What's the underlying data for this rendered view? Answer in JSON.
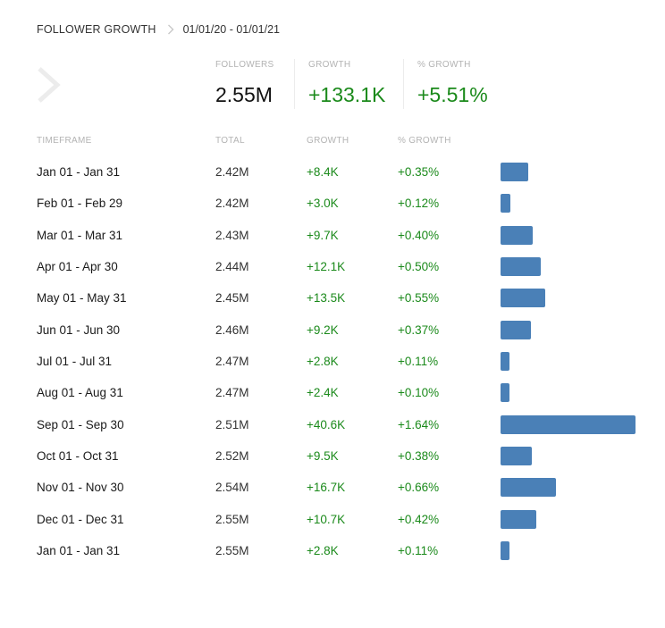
{
  "breadcrumb": {
    "title": "FOLLOWER GROWTH",
    "range": "01/01/20 - 01/01/21"
  },
  "summary": {
    "followers_label": "FOLLOWERS",
    "followers_value": "2.55M",
    "growth_label": "GROWTH",
    "growth_value": "+133.1K",
    "pct_label": "% GROWTH",
    "pct_value": "+5.51%"
  },
  "table": {
    "headers": {
      "timeframe": "TIMEFRAME",
      "total": "TOTAL",
      "growth": "GROWTH",
      "pct": "% GROWTH"
    },
    "rows": [
      {
        "timeframe": "Jan 01 - Jan 31",
        "total": "2.42M",
        "growth": "+8.4K",
        "pct": "+0.35%",
        "growth_num": 8.4
      },
      {
        "timeframe": "Feb 01 - Feb 29",
        "total": "2.42M",
        "growth": "+3.0K",
        "pct": "+0.12%",
        "growth_num": 3.0
      },
      {
        "timeframe": "Mar 01 - Mar 31",
        "total": "2.43M",
        "growth": "+9.7K",
        "pct": "+0.40%",
        "growth_num": 9.7
      },
      {
        "timeframe": "Apr 01 - Apr 30",
        "total": "2.44M",
        "growth": "+12.1K",
        "pct": "+0.50%",
        "growth_num": 12.1
      },
      {
        "timeframe": "May 01 - May 31",
        "total": "2.45M",
        "growth": "+13.5K",
        "pct": "+0.55%",
        "growth_num": 13.5
      },
      {
        "timeframe": "Jun 01 - Jun 30",
        "total": "2.46M",
        "growth": "+9.2K",
        "pct": "+0.37%",
        "growth_num": 9.2
      },
      {
        "timeframe": "Jul 01 - Jul 31",
        "total": "2.47M",
        "growth": "+2.8K",
        "pct": "+0.11%",
        "growth_num": 2.8
      },
      {
        "timeframe": "Aug 01 - Aug 31",
        "total": "2.47M",
        "growth": "+2.4K",
        "pct": "+0.10%",
        "growth_num": 2.4
      },
      {
        "timeframe": "Sep 01 - Sep 30",
        "total": "2.51M",
        "growth": "+40.6K",
        "pct": "+1.64%",
        "growth_num": 40.6
      },
      {
        "timeframe": "Oct 01 - Oct 31",
        "total": "2.52M",
        "growth": "+9.5K",
        "pct": "+0.38%",
        "growth_num": 9.5
      },
      {
        "timeframe": "Nov 01 - Nov 30",
        "total": "2.54M",
        "growth": "+16.7K",
        "pct": "+0.66%",
        "growth_num": 16.7
      },
      {
        "timeframe": "Dec 01 - Dec 31",
        "total": "2.55M",
        "growth": "+10.7K",
        "pct": "+0.42%",
        "growth_num": 10.7
      },
      {
        "timeframe": "Jan 01 - Jan 31",
        "total": "2.55M",
        "growth": "+2.8K",
        "pct": "+0.11%",
        "growth_num": 2.8
      }
    ]
  },
  "icons": {
    "breadcrumb_separator": "chevron-right-icon",
    "back_arrow": "chevron-right-icon"
  },
  "colors": {
    "positive": "#1b8a1b",
    "bar": "#4a80b7",
    "muted_label": "#b3b3b3"
  }
}
